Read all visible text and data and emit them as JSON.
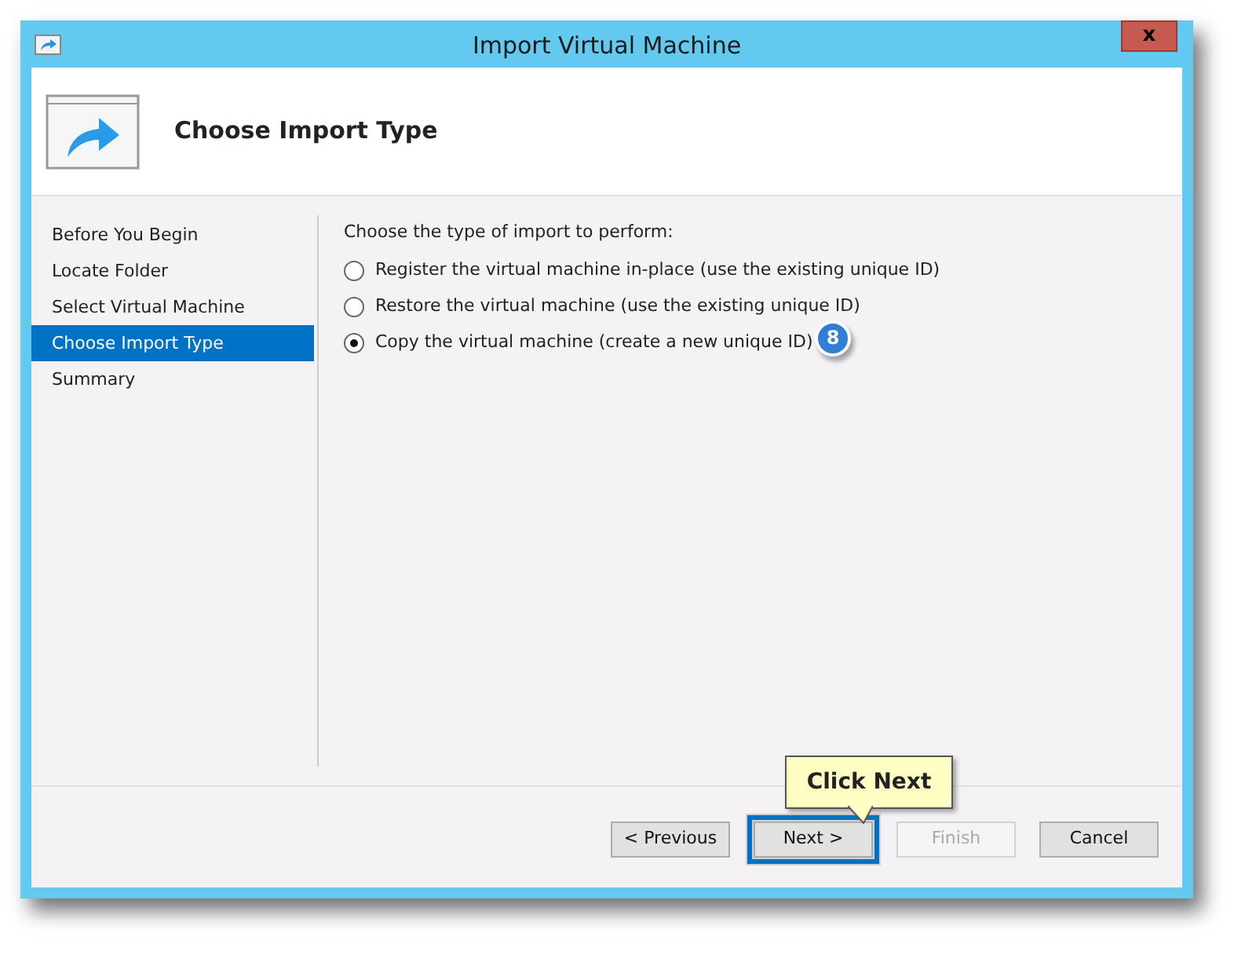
{
  "window": {
    "title": "Import Virtual Machine",
    "close": "x"
  },
  "header": {
    "title": "Choose Import Type"
  },
  "sidebar": {
    "items": [
      {
        "label": "Before You Begin",
        "selected": false
      },
      {
        "label": "Locate Folder",
        "selected": false
      },
      {
        "label": "Select Virtual Machine",
        "selected": false
      },
      {
        "label": "Choose Import Type",
        "selected": true
      },
      {
        "label": "Summary",
        "selected": false
      }
    ]
  },
  "content": {
    "prompt": "Choose the type of import to perform:",
    "options": [
      {
        "label": "Register the virtual machine in-place (use the existing unique ID)",
        "selected": false
      },
      {
        "label": "Restore the virtual machine (use the existing unique ID)",
        "selected": false
      },
      {
        "label": "Copy the virtual machine (create a new unique ID)",
        "selected": true
      }
    ],
    "step_marker": "8"
  },
  "buttons": [
    {
      "label": "< Previous",
      "disabled": false,
      "highlighted": false
    },
    {
      "label": "Next >",
      "disabled": false,
      "highlighted": true
    },
    {
      "label": "Finish",
      "disabled": true,
      "highlighted": false
    },
    {
      "label": "Cancel",
      "disabled": false,
      "highlighted": false
    }
  ],
  "callout": {
    "text": "Click Next"
  }
}
